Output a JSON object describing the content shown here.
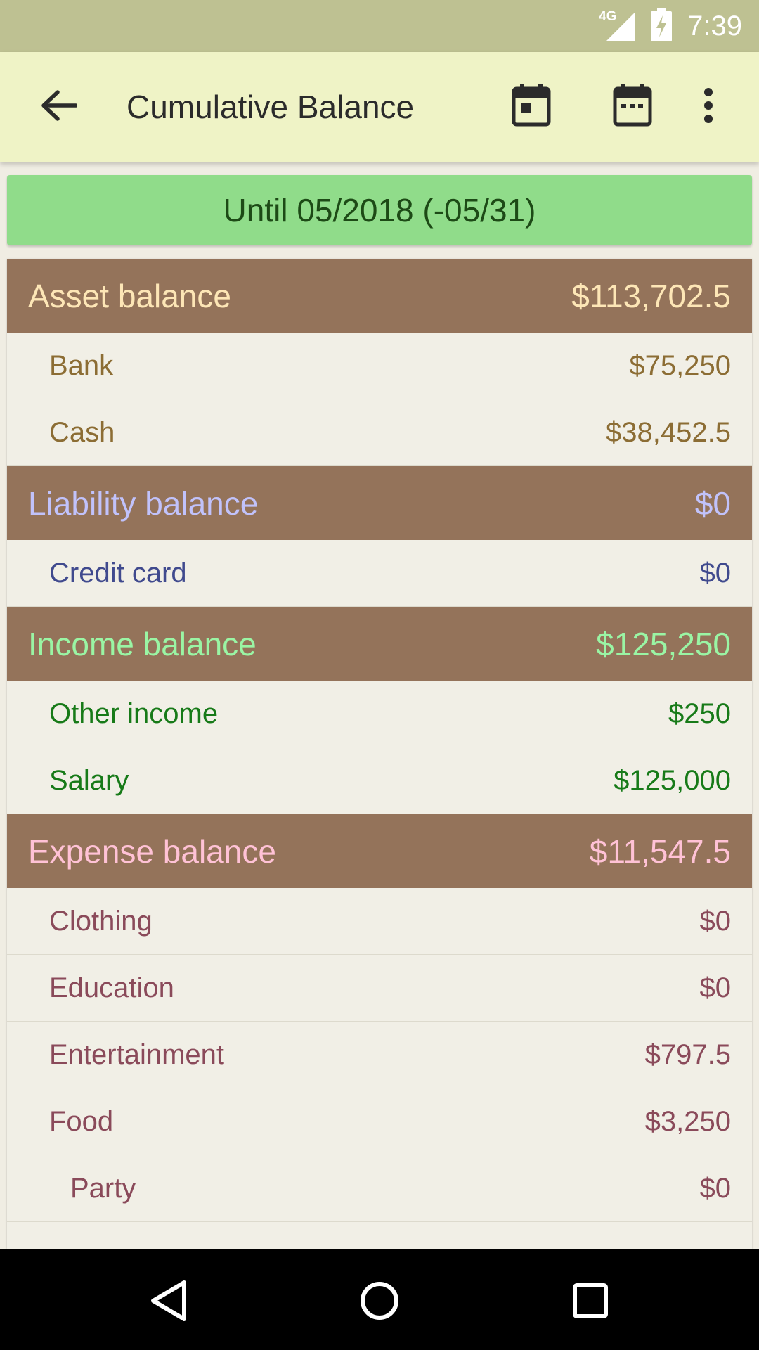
{
  "status_bar": {
    "network": "4G",
    "time": "7:39"
  },
  "app_bar": {
    "title": "Cumulative Balance",
    "icons": [
      "arrow-back-icon",
      "calendar-today-icon",
      "calendar-month-icon",
      "more-vert-icon"
    ]
  },
  "period": {
    "label": "Until 05/2018 (-05/31)"
  },
  "sections": {
    "asset": {
      "title": "Asset balance",
      "total": "$113,702.5",
      "items": [
        {
          "name": "Bank",
          "amount": "$75,250"
        },
        {
          "name": "Cash",
          "amount": "$38,452.5"
        }
      ]
    },
    "liability": {
      "title": "Liability balance",
      "total": "$0",
      "items": [
        {
          "name": "Credit card",
          "amount": "$0"
        }
      ]
    },
    "income": {
      "title": "Income balance",
      "total": "$125,250",
      "items": [
        {
          "name": "Other income",
          "amount": "$250"
        },
        {
          "name": "Salary",
          "amount": "$125,000"
        }
      ]
    },
    "expense": {
      "title": "Expense balance",
      "total": "$11,547.5",
      "items": [
        {
          "name": "Clothing",
          "amount": "$0"
        },
        {
          "name": "Education",
          "amount": "$0"
        },
        {
          "name": "Entertainment",
          "amount": "$797.5"
        },
        {
          "name": "Food",
          "amount": "$3,250"
        },
        {
          "name": "Party",
          "amount": "$0"
        }
      ]
    }
  },
  "colors": {
    "status_bar": "#bec192",
    "app_bar": "#eff3c6",
    "period_bg": "#90dc8a",
    "section_header_bg": "#94735a",
    "row_bg": "#f1efe6",
    "asset_header": "#fde6b6",
    "asset_item": "#8c6d34",
    "liability_header": "#c1c2fb",
    "liability_item": "#404a8e",
    "income_header": "#9af5a4",
    "income_item": "#177a18",
    "expense_header": "#ffc2d6",
    "expense_item": "#8a4a5a"
  },
  "nav_bar": {
    "icons": [
      "nav-back-icon",
      "nav-home-icon",
      "nav-recents-icon"
    ]
  }
}
